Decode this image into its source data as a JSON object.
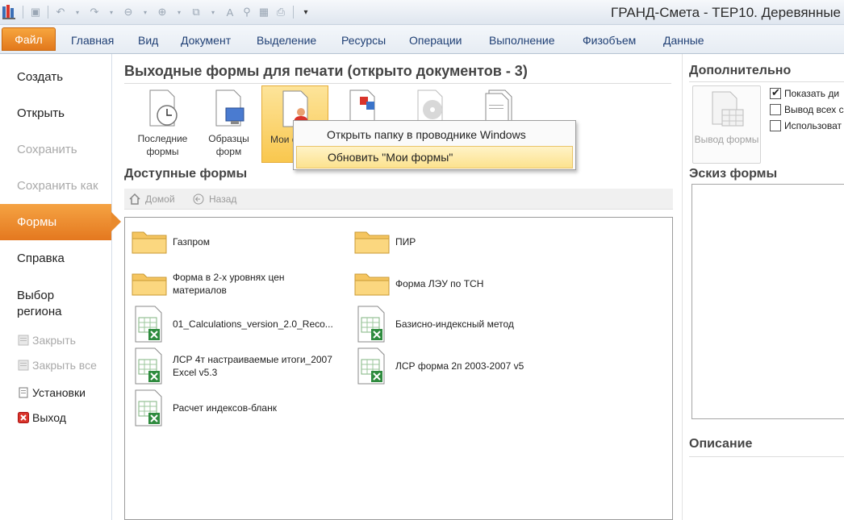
{
  "window": {
    "title": "ГРАНД-Смета - ТЕР10. Деревянные"
  },
  "ribbon": {
    "file_tab": "Файл",
    "tabs": [
      "Главная",
      "Вид",
      "Документ",
      "Выделение",
      "Ресурсы",
      "Операции",
      "Выполнение",
      "Физобъем",
      "Данные"
    ]
  },
  "leftnav": {
    "items": [
      "Создать",
      "Открыть",
      "Сохранить",
      "Сохранить как",
      "Формы",
      "Справка",
      "Выбор\nрегиона"
    ],
    "close": "Закрыть",
    "close_all": "Закрыть все",
    "settings": "Установки",
    "exit": "Выход"
  },
  "main": {
    "heading": "Выходные формы для печати (открыто документов - 3)",
    "gallery": [
      {
        "label": "Последние формы",
        "icon": "clock-document-icon"
      },
      {
        "label": "Образцы форм",
        "icon": "computer-document-icon"
      },
      {
        "label": "Мои ф",
        "icon": "user-document-icon"
      },
      {
        "label": "",
        "icon": "office-document-icon"
      },
      {
        "label": "",
        "icon": "cd-document-icon"
      },
      {
        "label": "",
        "icon": "pages-document-icon"
      }
    ],
    "available_heading": "Доступные формы",
    "nav_home": "Домой",
    "nav_back": "Назад",
    "files": [
      {
        "name": "Газпром",
        "type": "folder"
      },
      {
        "name": "ПИР",
        "type": "folder"
      },
      {
        "name": "Форма в 2-х уровнях цен материалов",
        "type": "folder"
      },
      {
        "name": "Форма ЛЭУ по ТСН",
        "type": "folder"
      },
      {
        "name": "01_Calculations_version_2.0_Reco...",
        "type": "excel"
      },
      {
        "name": "Базисно-индексный метод",
        "type": "excel"
      },
      {
        "name": "ЛСР 4т настраиваемые итоги_2007 Excel v5.3",
        "type": "excel"
      },
      {
        "name": "ЛСР форма 2п 2003-2007 v5",
        "type": "excel"
      },
      {
        "name": "Расчет индексов-бланк",
        "type": "excel"
      }
    ]
  },
  "context_menu": {
    "items": [
      "Открыть папку в проводнике Windows",
      "Обновить \"Мои формы\""
    ]
  },
  "right": {
    "heading": "Дополнительно",
    "output_button": "Вывод формы",
    "checkboxes": [
      {
        "label": "Показать ди",
        "checked": true
      },
      {
        "label": "Вывод всех с",
        "checked": false
      },
      {
        "label": "Использоват",
        "checked": false
      }
    ],
    "sketch_heading": "Эскиз формы",
    "description_heading": "Описание"
  },
  "colors": {
    "accent": "#e98a2c",
    "tab_text": "#1f3f74",
    "hover": "#fce28e"
  }
}
